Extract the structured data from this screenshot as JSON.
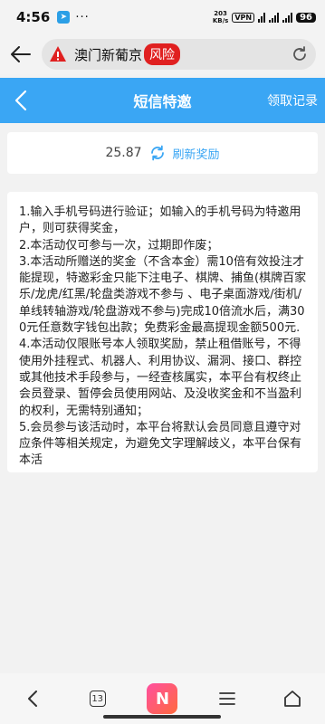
{
  "status_bar": {
    "time": "4:56",
    "dots": "···",
    "net_speed_top": "203",
    "net_speed_bottom": "KB/s",
    "vpn": "VPN",
    "battery": "96"
  },
  "url_bar": {
    "site_name": "澳门新葡京",
    "risk_label": "风险"
  },
  "header": {
    "title": "短信特邀",
    "right_link": "领取记录"
  },
  "balance": {
    "value": "25.87",
    "refresh_label": "刷新奖励"
  },
  "rules": [
    "1.输入手机号码进行验证；如输入的手机号码为特邀用户，则可获得奖金，",
    "2.本活动仅可参与一次，过期即作废；",
    "3.本活动所赠送的奖金（不含本金）需10倍有效投注才能提现，特邀彩金只能下注电子、棋牌、捕鱼(棋牌百家乐/龙虎/红黑/轮盘类游戏不参与 、电子桌面游戏/街机/单线转轴游戏/轮盘游戏不参与)完成10倍流水后，满300元任意数字钱包出款；免费彩金最高提现金额500元.",
    "4.本活动仅限账号本人领取奖励，禁止租借账号，不得使用外挂程式、机器人、利用协议、漏洞、接口、群控或其他技术手段参与，一经查核属实，本平台有权终止会员登录、暂停会员使用网站、及没收奖金和不当盈利的权利，无需特别通知；",
    "5.会员参与该活动时，本平台将默认会员同意且遵守对应条件等相关规定，为避免文字理解歧义，本平台保有本活"
  ],
  "bottom_nav": {
    "tab_count": "13",
    "logo_letter": "N"
  }
}
